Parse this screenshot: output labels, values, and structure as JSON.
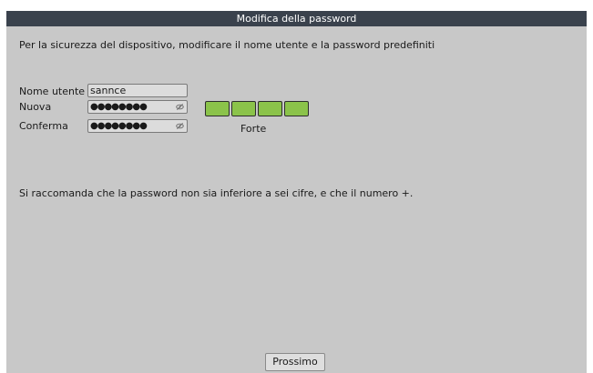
{
  "dialog": {
    "title": "Modifica della password",
    "intro": "Per la sicurezza del dispositivo, modificare il nome utente e la password predefiniti",
    "username_label": "Nome utente",
    "username_value": "sannce",
    "new_label": "Nuova",
    "new_value_masked": "●●●●●●●●",
    "confirm_label": "Conferma",
    "confirm_value_masked": "●●●●●●●●",
    "strength_label": "Forte",
    "strength_segments_filled": 4,
    "strength_segments_total": 4,
    "strength_color": "#8bc34a",
    "hint": "Si raccomanda che la password non sia inferiore a sei cifre, e che il numero +.",
    "next_button": "Prossimo",
    "eye_icon": "eye-hidden-icon"
  }
}
